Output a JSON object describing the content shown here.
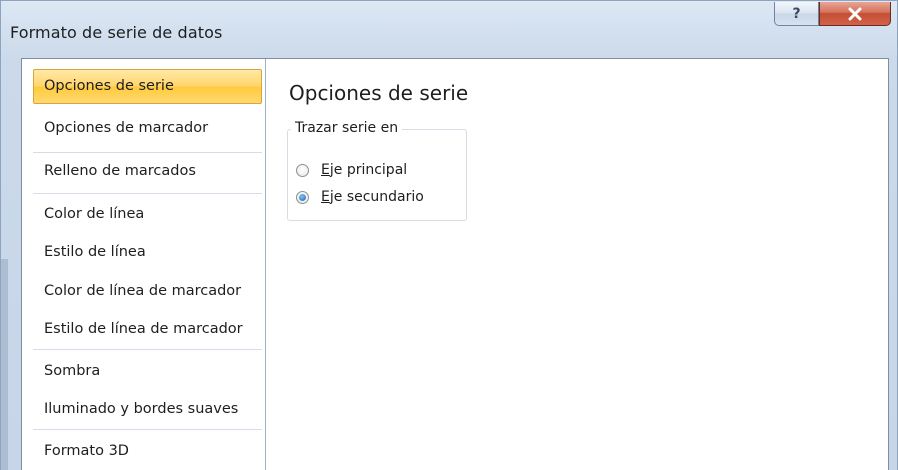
{
  "window": {
    "title": "Formato de serie de datos",
    "help_icon": "?",
    "close_icon": "close-x"
  },
  "sidebar": {
    "items": [
      {
        "label": "Opciones de serie",
        "selected": true
      },
      {
        "label": "Opciones de marcador",
        "selected": false
      },
      {
        "label": "Relleno de marcados",
        "selected": false
      },
      {
        "label": "Color de línea",
        "selected": false
      },
      {
        "label": "Estilo de línea",
        "selected": false
      },
      {
        "label": "Color de línea de marcador",
        "selected": false
      },
      {
        "label": "Estilo de línea de marcador",
        "selected": false
      },
      {
        "label": "Sombra",
        "selected": false
      },
      {
        "label": "Iluminado y bordes suaves",
        "selected": false
      },
      {
        "label": "Formato 3D",
        "selected": false
      }
    ]
  },
  "panel": {
    "title": "Opciones de serie",
    "group_label": "Trazar serie en",
    "options": [
      {
        "underlined_char": "E",
        "rest": "je principal",
        "checked": false
      },
      {
        "underlined_char": "E",
        "rest": "je secundario",
        "checked": true
      }
    ]
  },
  "colors": {
    "selected_item": "#ffd56a",
    "window_frame": "#cbd9ea",
    "close_button": "#c34e34",
    "radio_checked": "#1d66b0"
  }
}
